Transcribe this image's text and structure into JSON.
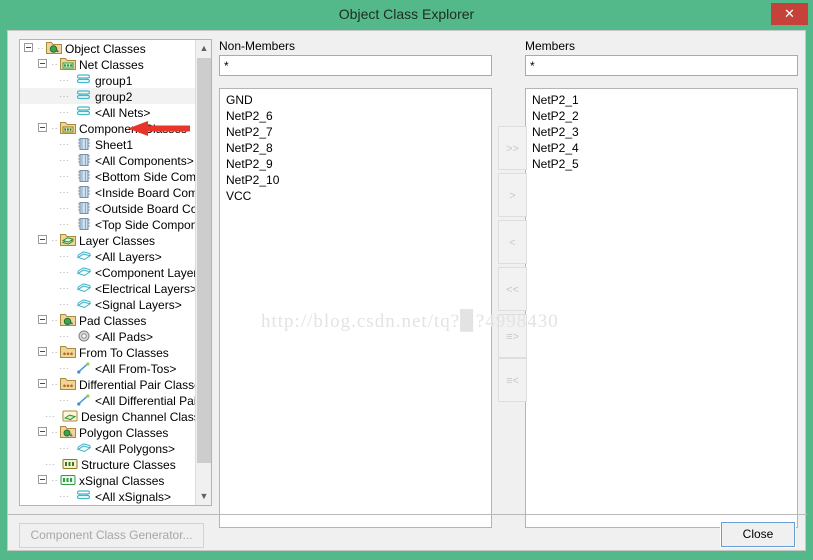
{
  "window": {
    "title": "Object Class Explorer",
    "close_icon": "close-x-icon",
    "frame_color": "#54b98a",
    "close_button_color": "#c7413b"
  },
  "tree": {
    "scroll_up_icon": "chevron-up-icon",
    "scroll_down_icon": "chevron-down-icon",
    "items": [
      {
        "label": "Object Classes",
        "depth": 0,
        "expander": "minus",
        "icon": "object-classes-icon",
        "selected": false
      },
      {
        "label": "Net Classes",
        "depth": 1,
        "expander": "minus",
        "icon": "net-classes-icon",
        "selected": false
      },
      {
        "label": "group1",
        "depth": 2,
        "expander": "none",
        "icon": "net-icon",
        "selected": false
      },
      {
        "label": "group2",
        "depth": 2,
        "expander": "none",
        "icon": "net-icon",
        "selected": true
      },
      {
        "label": "<All Nets>",
        "depth": 2,
        "expander": "none",
        "icon": "net-icon",
        "selected": false
      },
      {
        "label": "Component Classes",
        "depth": 1,
        "expander": "minus",
        "icon": "component-classes-icon",
        "selected": false
      },
      {
        "label": "Sheet1",
        "depth": 2,
        "expander": "none",
        "icon": "component-icon",
        "selected": false
      },
      {
        "label": "<All Components>",
        "depth": 2,
        "expander": "none",
        "icon": "component-icon",
        "selected": false
      },
      {
        "label": "<Bottom Side Components>",
        "depth": 2,
        "expander": "none",
        "icon": "component-icon",
        "selected": false
      },
      {
        "label": "<Inside Board Components>",
        "depth": 2,
        "expander": "none",
        "icon": "component-icon",
        "selected": false
      },
      {
        "label": "<Outside Board Components>",
        "depth": 2,
        "expander": "none",
        "icon": "component-icon",
        "selected": false
      },
      {
        "label": "<Top Side Components>",
        "depth": 2,
        "expander": "none",
        "icon": "component-icon",
        "selected": false
      },
      {
        "label": "Layer Classes",
        "depth": 1,
        "expander": "minus",
        "icon": "layer-classes-icon",
        "selected": false
      },
      {
        "label": "<All Layers>",
        "depth": 2,
        "expander": "none",
        "icon": "layer-icon",
        "selected": false
      },
      {
        "label": "<Component Layers>",
        "depth": 2,
        "expander": "none",
        "icon": "layer-icon",
        "selected": false
      },
      {
        "label": "<Electrical Layers>",
        "depth": 2,
        "expander": "none",
        "icon": "layer-icon",
        "selected": false
      },
      {
        "label": "<Signal Layers>",
        "depth": 2,
        "expander": "none",
        "icon": "layer-icon",
        "selected": false
      },
      {
        "label": "Pad Classes",
        "depth": 1,
        "expander": "minus",
        "icon": "pad-classes-icon",
        "selected": false
      },
      {
        "label": "<All Pads>",
        "depth": 2,
        "expander": "none",
        "icon": "pad-icon",
        "selected": false
      },
      {
        "label": "From To Classes",
        "depth": 1,
        "expander": "minus",
        "icon": "fromto-classes-icon",
        "selected": false
      },
      {
        "label": "<All From-Tos>",
        "depth": 2,
        "expander": "none",
        "icon": "fromto-icon",
        "selected": false
      },
      {
        "label": "Differential Pair Classes",
        "depth": 1,
        "expander": "minus",
        "icon": "diffpair-classes-icon",
        "selected": false
      },
      {
        "label": "<All Differential Pairs>",
        "depth": 2,
        "expander": "none",
        "icon": "diffpair-icon",
        "selected": false
      },
      {
        "label": "Design Channel Classes",
        "depth": 1,
        "expander": "none",
        "icon": "design-channel-icon",
        "selected": false
      },
      {
        "label": "Polygon Classes",
        "depth": 1,
        "expander": "minus",
        "icon": "polygon-classes-icon",
        "selected": false
      },
      {
        "label": "<All Polygons>",
        "depth": 2,
        "expander": "none",
        "icon": "polygon-icon",
        "selected": false
      },
      {
        "label": "Structure Classes",
        "depth": 1,
        "expander": "none",
        "icon": "structure-classes-icon",
        "selected": false
      },
      {
        "label": "xSignal Classes",
        "depth": 1,
        "expander": "minus",
        "icon": "xsignal-classes-icon",
        "selected": false
      },
      {
        "label": "<All xSignals>",
        "depth": 2,
        "expander": "none",
        "icon": "xsignal-icon",
        "selected": false
      }
    ]
  },
  "non_members": {
    "label": "Non-Members",
    "filter_value": "*",
    "items": [
      "GND",
      "NetP2_6",
      "NetP2_7",
      "NetP2_8",
      "NetP2_9",
      "NetP2_10",
      "VCC"
    ]
  },
  "members": {
    "label": "Members",
    "filter_value": "*",
    "items": [
      "NetP2_1",
      "NetP2_2",
      "NetP2_3",
      "NetP2_4",
      "NetP2_5"
    ]
  },
  "transfer_buttons": [
    {
      "label": ">>",
      "name": "move-all-right-button"
    },
    {
      "label": ">",
      "name": "move-right-button"
    },
    {
      "label": "<",
      "name": "move-left-button"
    },
    {
      "label": "<<",
      "name": "move-all-left-button"
    },
    {
      "label": "≡>",
      "name": "move-selected-right-button"
    },
    {
      "label": "≡<",
      "name": "move-selected-left-button"
    }
  ],
  "footer": {
    "generator_label": "Component Class Generator...",
    "close_label": "Close"
  },
  "annotation": {
    "arrow_color": "#e8352a",
    "arrow_target": "group2"
  },
  "watermark": {
    "text": "http://blog.csdn.net/tq?▉?4998430"
  }
}
